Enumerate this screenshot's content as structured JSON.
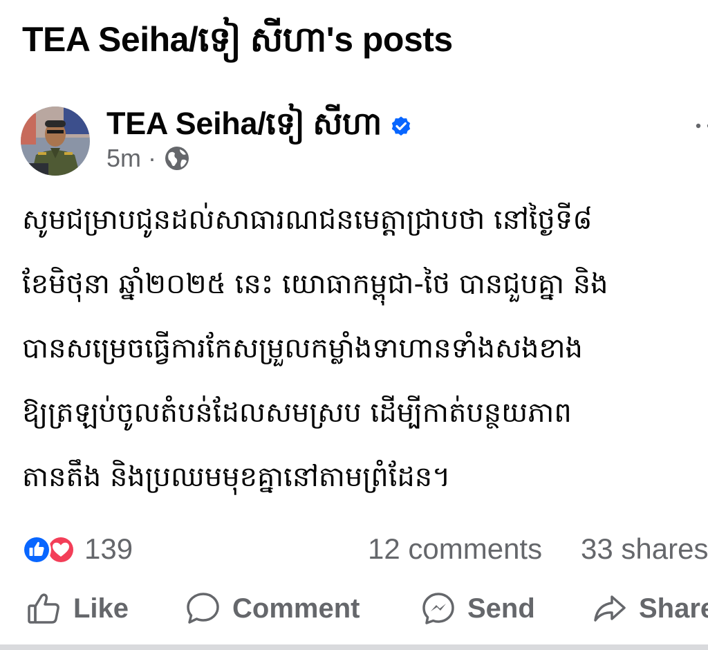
{
  "page": {
    "title": "TEA Seiha/ទៀ សីហា's posts"
  },
  "post": {
    "author": "TEA Seiha/ទៀ សីហា",
    "time": "5m",
    "separator": "·",
    "privacy_icon": "globe-icon",
    "verified_icon": "verified-badge-icon",
    "more_icon": "more-options-icon",
    "body_lines": [
      "សូមជម្រាបជូនដល់សាធារណជនមេត្តាជ្រាបថា នៅថ្ងៃទី៨",
      "ខែមិថុនា ឆ្នាំ២០២៥ នេះ យោធាកម្ពុជា-ថៃ បានជួបគ្នា និង",
      "បានសម្រេចធ្វើការកែសម្រួលកម្លាំងទាហានទាំងសងខាង",
      "ឱ្យត្រឡប់ចូលតំបន់ដែលសមស្រប ដើម្បីកាត់បន្ថយភាព",
      "តានតឹង និងប្រឈមមុខគ្នានៅតាមព្រំដែន។"
    ]
  },
  "stats": {
    "reactions_count": "139",
    "reaction_icons": [
      "like-reaction-icon",
      "love-reaction-icon"
    ],
    "comments": "12 comments",
    "shares": "33 shares"
  },
  "actions": {
    "like": "Like",
    "comment": "Comment",
    "send": "Send",
    "share": "Share"
  },
  "colors": {
    "text": "#050505",
    "secondary": "#65676b",
    "facebook_blue": "#0866ff",
    "love_red": "#f33e58"
  }
}
